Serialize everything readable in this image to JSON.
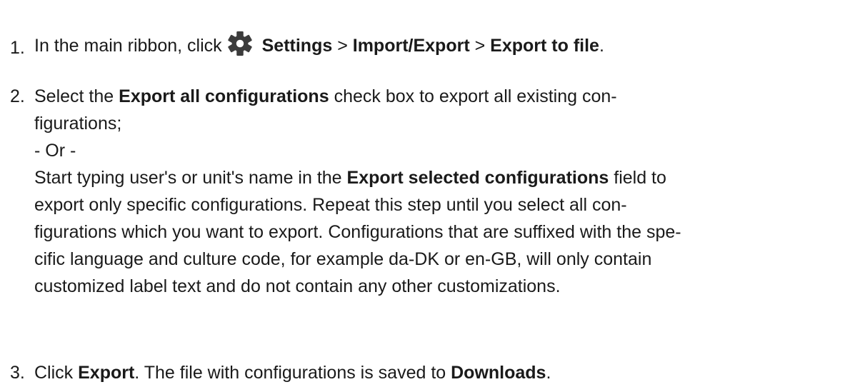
{
  "steps": [
    {
      "number": "1.",
      "intro": "In the main ribbon, click",
      "icon": "gear-icon",
      "settings": "Settings",
      "sep1": " > ",
      "import_export": "Import/Export",
      "sep2": " > ",
      "export_to_file": "Export to file",
      "end": "."
    },
    {
      "number": "2.",
      "l1_pre": "Select the ",
      "l1_bold": "Export all configurations",
      "l1_post": " check box to export all existing con-",
      "l2": "figurations;",
      "l3": "- Or -",
      "l4_pre": "Start typing user's or unit's name in the ",
      "l4_bold": "Export selected configurations",
      "l4_post": " field to",
      "l5": "export only specific configurations. Repeat this step until you select all con-",
      "l6": "figurations which you want to export. Configurations that are suffixed with the spe-",
      "l7": "cific language and culture code, for example da-DK or en-GB, will only contain",
      "l8": "customized label text and do not contain any other customizations."
    },
    {
      "number": "3.",
      "pre": "Click ",
      "export": "Export",
      "mid": ". The file with configurations is saved to ",
      "downloads": "Downloads",
      "end": "."
    }
  ],
  "colors": {
    "text": "#1a1a1a",
    "icon": "#3c3c3c"
  }
}
